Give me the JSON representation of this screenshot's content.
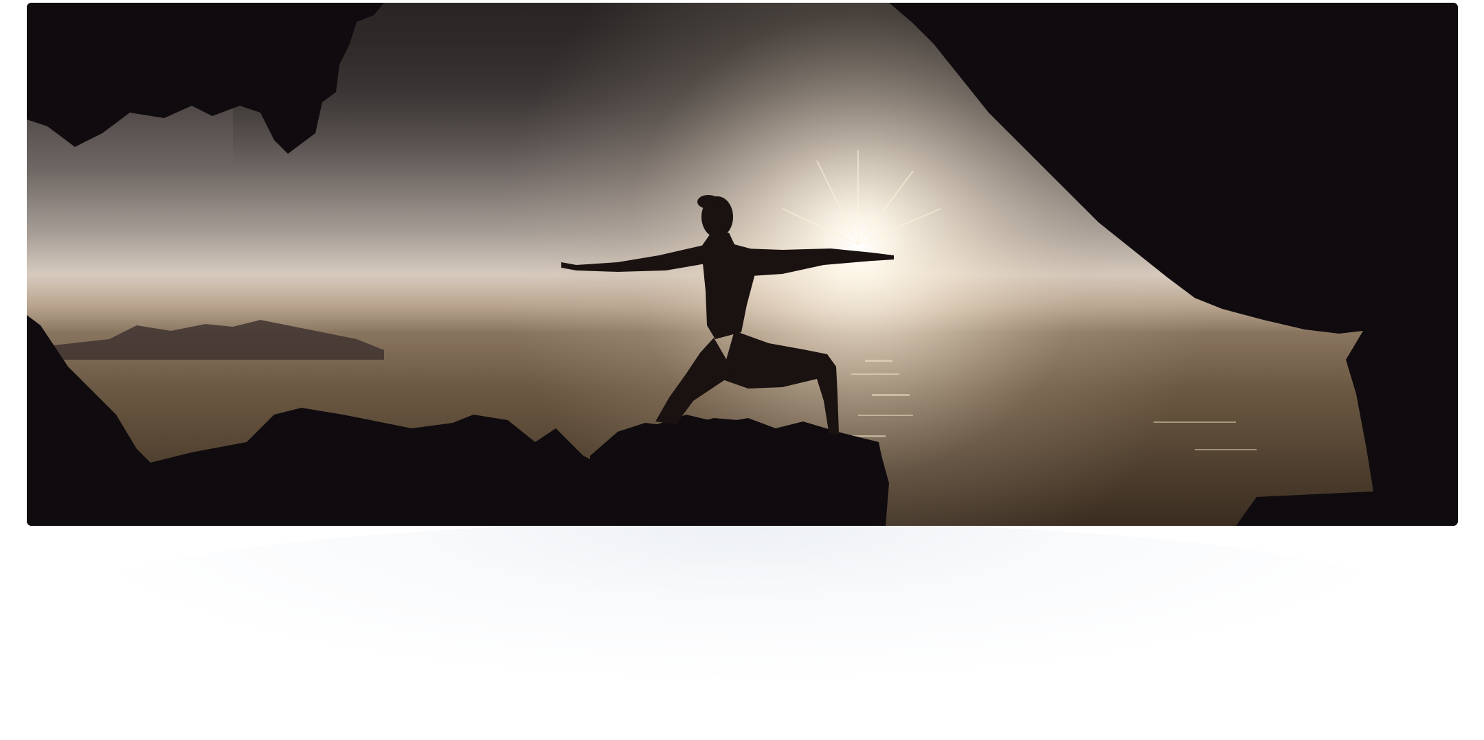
{
  "hero": {
    "image_description_icon": "yoga-silhouette-cave-sunset",
    "colors": {
      "frame_background": "#0e0b0d",
      "sky_top": "#3a3534",
      "sky_glow": "#fff6e8",
      "sea": "#5c4a35",
      "rock": "#0f0b0e"
    }
  }
}
